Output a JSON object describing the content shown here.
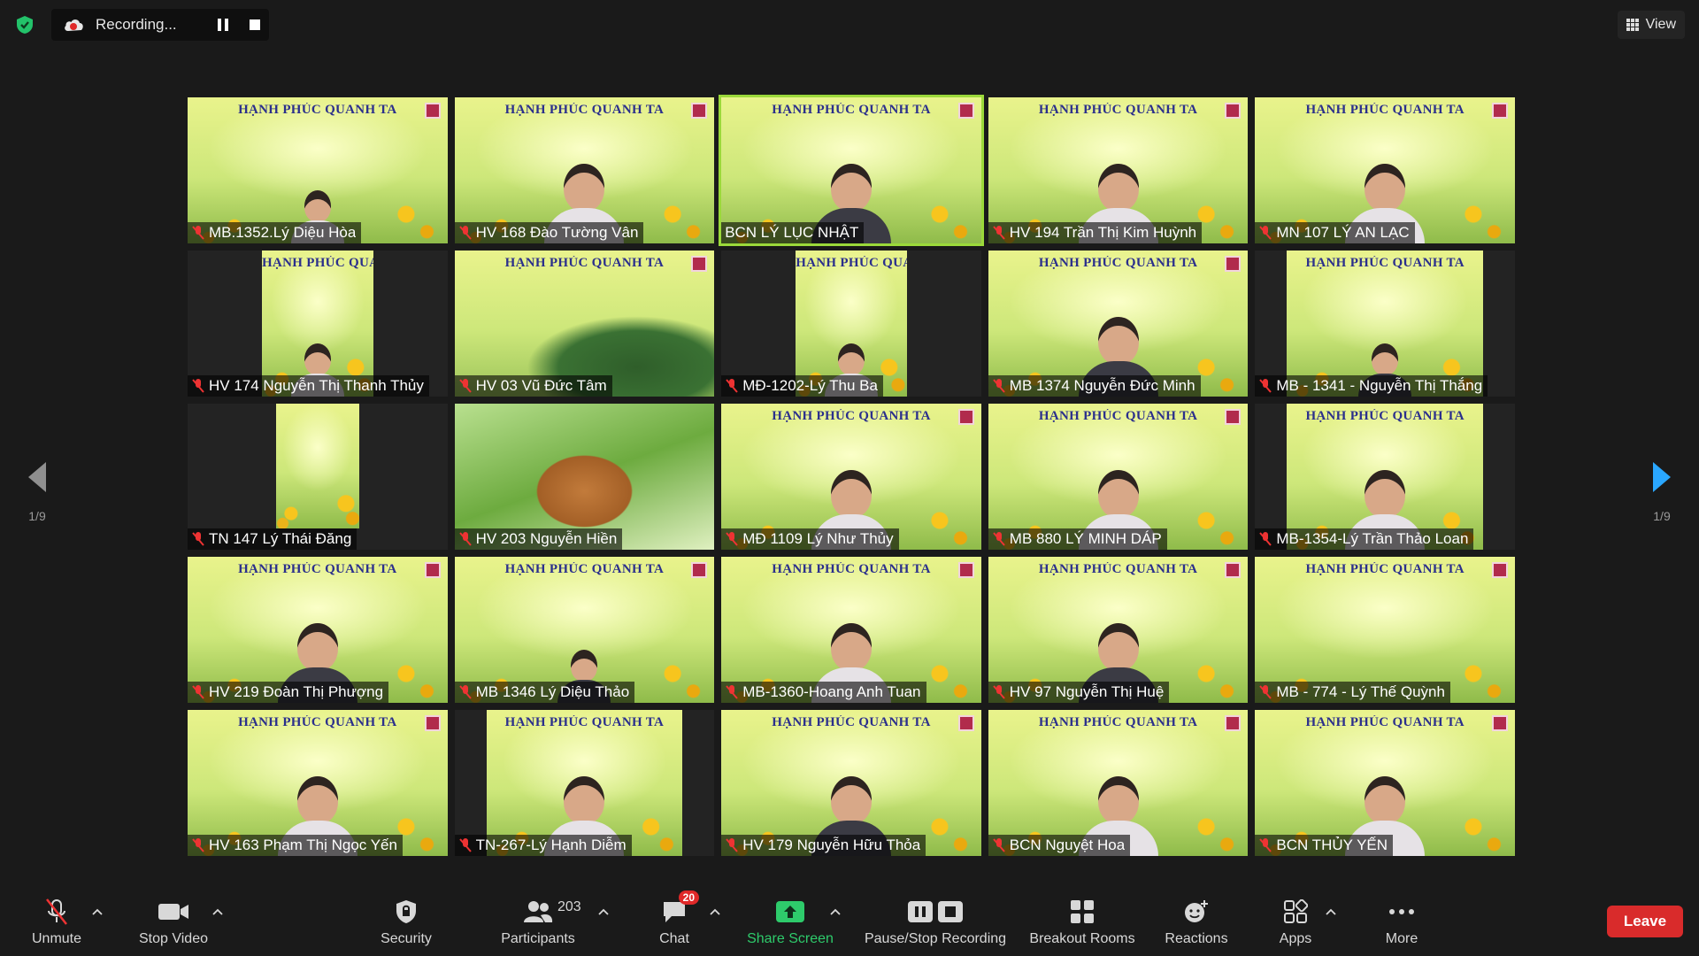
{
  "recording": {
    "label": "Recording..."
  },
  "view": {
    "label": "View"
  },
  "pagination": {
    "left": "1/9",
    "right": "1/9"
  },
  "brand": {
    "title": "HẠNH PHÚC QUANH TA"
  },
  "participants": [
    [
      "MB.1352.Lý Diệu Hòa",
      "HV 168 Đào Tường Vân",
      "BCN LÝ LỤC NHẬT",
      "HV 194  Trần Thị Kim Huỳnh",
      "MN 107 LÝ AN LẠC"
    ],
    [
      "HV 174 Nguyễn Thị Thanh Thủy",
      "HV 03 Vũ Đức Tâm",
      "MĐ-1202-Lý Thu Ba",
      "MB 1374 Nguyễn Đức Minh",
      "MB - 1341 - Nguyễn Thị Thắng"
    ],
    [
      "TN 147 Lý Thái Đăng",
      "HV 203 Nguyễn Hiền",
      "MĐ 1109 Lý Như Thủy",
      "MB 880 LÝ MINH DÁP",
      "MB-1354-Lý Trần Thảo Loan"
    ],
    [
      "HV 219 Đoàn Thị Phượng",
      "MB 1346 Lý Diệu Thảo",
      "MB-1360-Hoang Anh Tuan",
      "HV 97 Nguyễn Thị Huệ",
      "MB - 774 - Lý Thế Quỳnh"
    ],
    [
      "HV 163 Phạm Thị Ngọc Yến",
      "TN-267-Lý Hạnh Diễm",
      "HV 179 Nguyễn Hữu Thỏa",
      "BCN Nguyệt Hoa",
      "BCN THỦY YẾN"
    ]
  ],
  "toolbar": {
    "unmute": "Unmute",
    "stop_video": "Stop Video",
    "security": "Security",
    "participants": "Participants",
    "participants_count": "203",
    "chat": "Chat",
    "chat_badge": "20",
    "share_screen": "Share Screen",
    "pause_stop_recording": "Pause/Stop Recording",
    "breakout_rooms": "Breakout Rooms",
    "reactions": "Reactions",
    "apps": "Apps",
    "more": "More",
    "leave": "Leave"
  },
  "colors": {
    "accent_green": "#2ecb6b",
    "leave_red": "#d92b2b",
    "speaker_outline": "#9bd93a",
    "brand_blue": "#2b2f8c"
  }
}
